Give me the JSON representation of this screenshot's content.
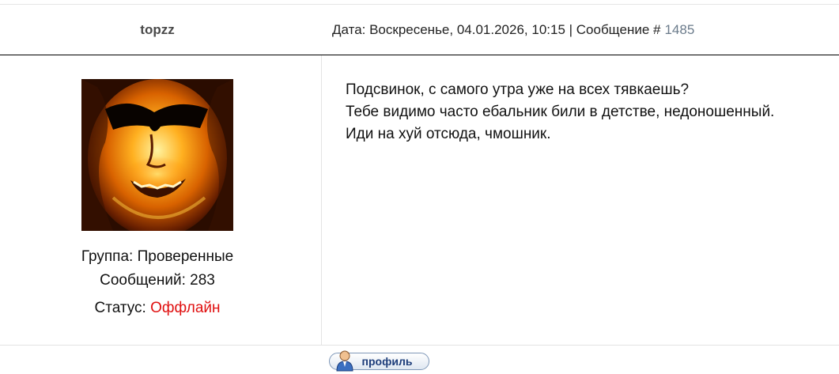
{
  "post": {
    "author": "topzz",
    "date_text": "Дата: Воскресенье, 04.01.2026, 10:15 | Сообщение #",
    "number": "1485"
  },
  "user": {
    "group_text": "Группа: Проверенные",
    "messages_text": "Сообщений: 283",
    "status_label": "Статус:",
    "status_value": "Оффлайн"
  },
  "message": {
    "lines": [
      "Подсвинок, с самого утра уже на всех тявкаешь?",
      "Тебе видимо часто ебальник били в детстве, недоношенный.",
      "Иди на хуй отсюда, чмошник."
    ]
  },
  "buttons": {
    "profile_label": "профиль"
  },
  "colors": {
    "status_offline": "#e01010",
    "post_number": "#6b7b8b",
    "button_text": "#1d3d7a"
  },
  "icons": {
    "profile_button": "user-icon"
  }
}
